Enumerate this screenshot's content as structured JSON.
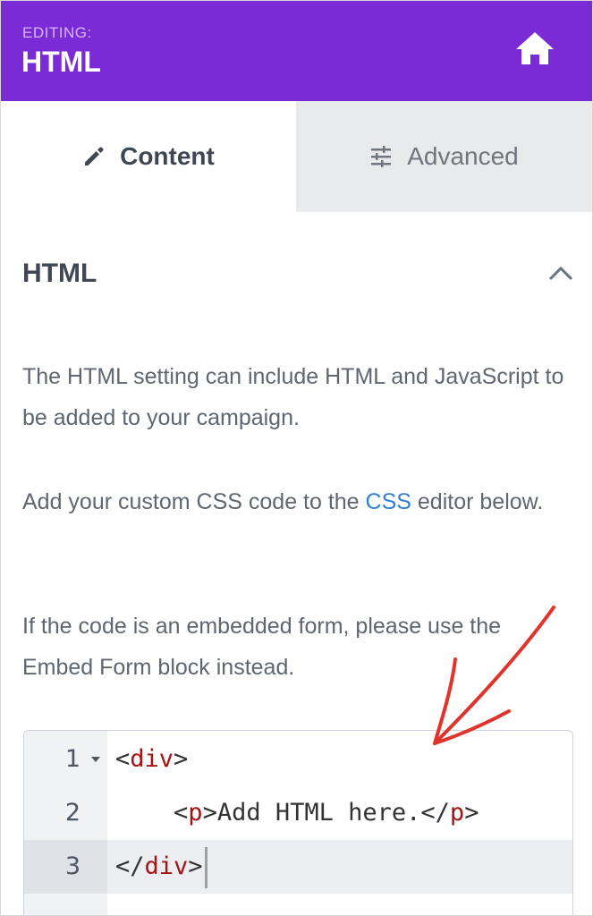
{
  "header": {
    "editing_label": "EDITING:",
    "title": "HTML",
    "home_icon": "home-icon"
  },
  "tabs": [
    {
      "label": "Content",
      "icon": "pencil-icon",
      "active": true
    },
    {
      "label": "Advanced",
      "icon": "sliders-icon",
      "active": false
    }
  ],
  "section": {
    "title": "HTML",
    "collapse_icon": "chevron-up-icon"
  },
  "description": {
    "p1": "The HTML setting can include HTML and JavaScript to be added to your campaign.",
    "p2_before": "Add your custom CSS code to the ",
    "p2_link": "CSS",
    "p2_after": " editor below.",
    "p3": "If the code is an embedded form, please use the Embed Form block instead."
  },
  "editor": {
    "lines": [
      {
        "num": "1",
        "indent": "",
        "open": "<",
        "tag": "div",
        "close": ">",
        "text": "",
        "open2": "",
        "tag2": "",
        "close2": ""
      },
      {
        "num": "2",
        "indent": "    ",
        "open": "<",
        "tag": "p",
        "close": ">",
        "text": "Add HTML here.",
        "open2": "</",
        "tag2": "p",
        "close2": ">"
      },
      {
        "num": "3",
        "indent": "",
        "open": "</",
        "tag": "div",
        "close": ">",
        "text": "",
        "open2": "",
        "tag2": "",
        "close2": ""
      }
    ]
  },
  "colors": {
    "header_bg": "#7b2bd6",
    "link": "#2f7ed8",
    "annotation_arrow": "#e0332b",
    "code_tag": "#a31515"
  }
}
